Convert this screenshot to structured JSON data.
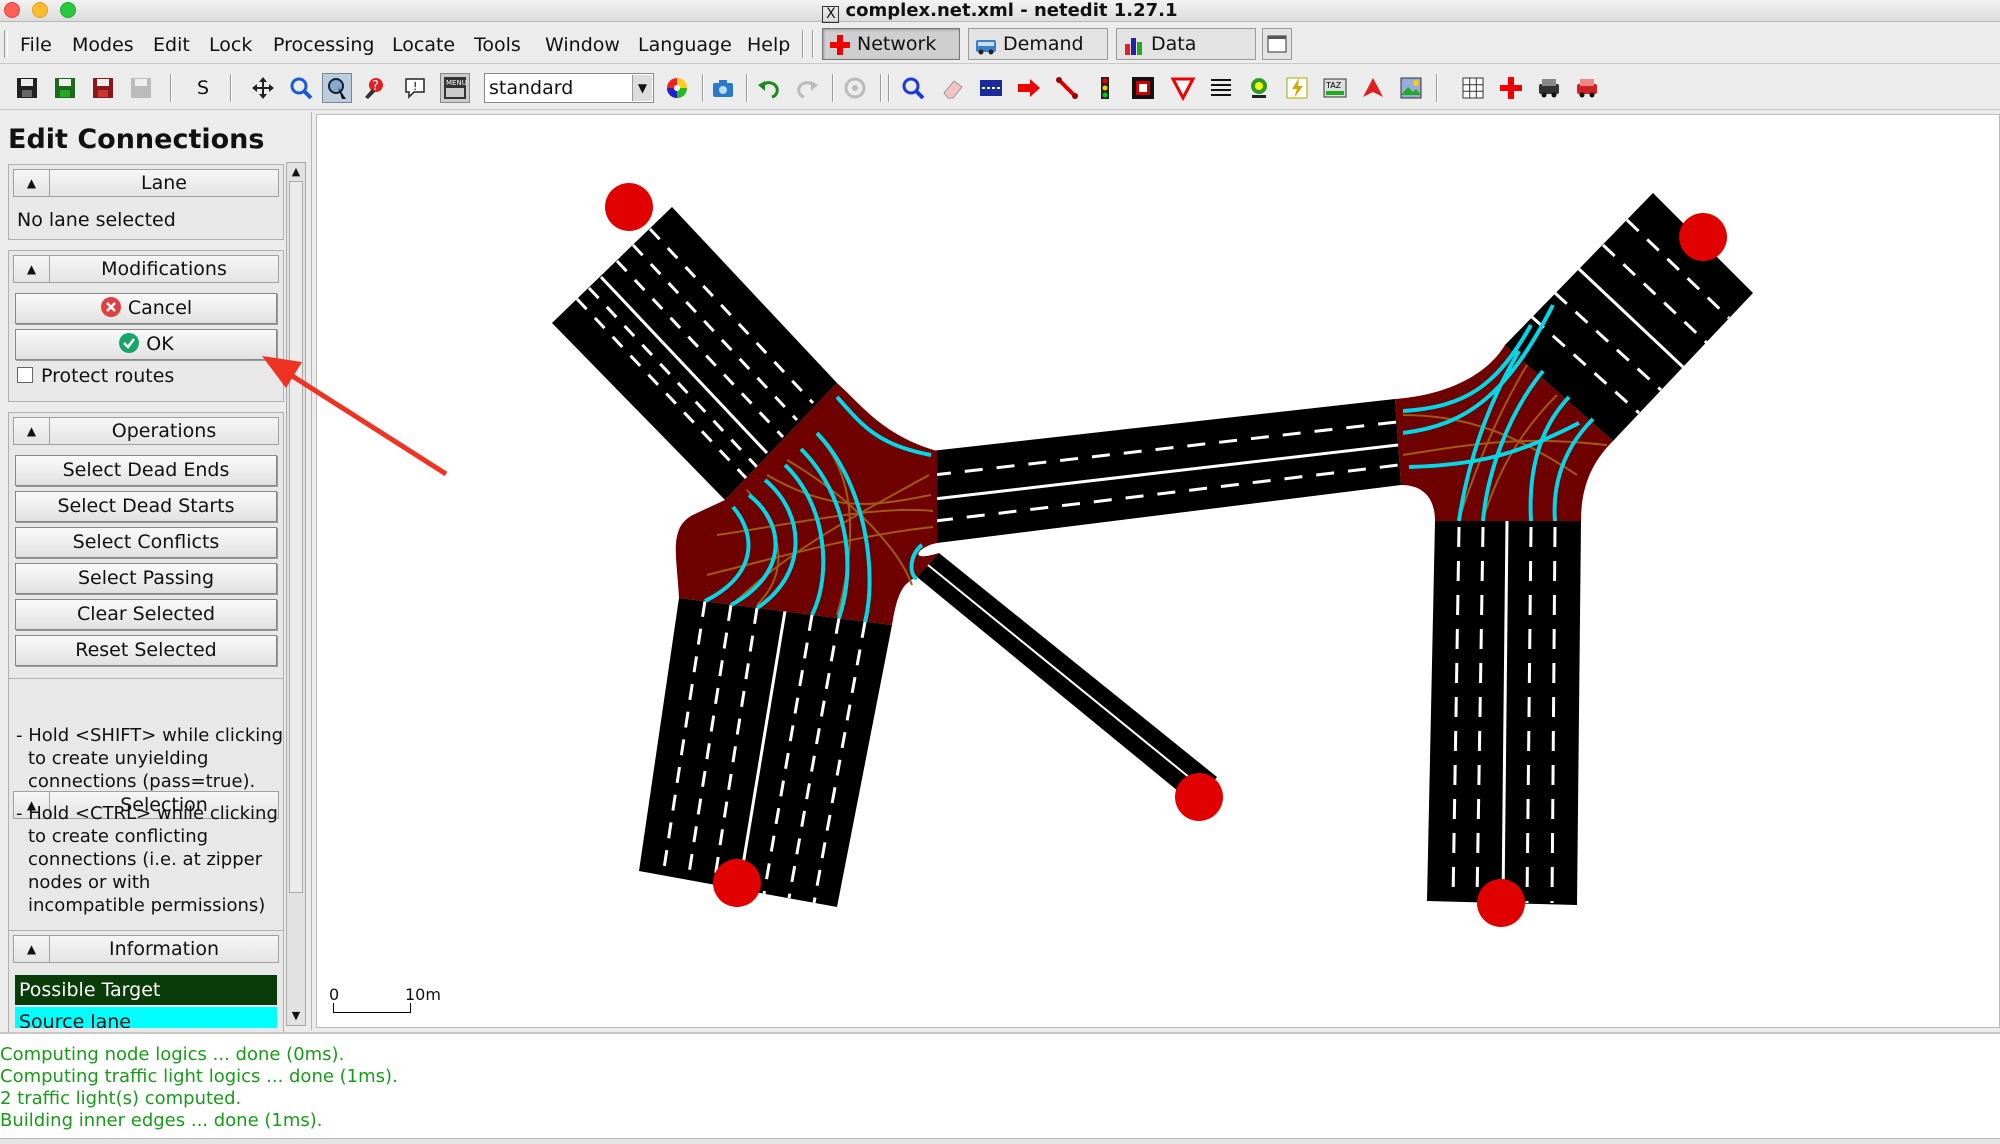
{
  "window": {
    "title": "complex.net.xml - netedit 1.27.1",
    "title_icon": "X"
  },
  "menubar": {
    "items": [
      "File",
      "Modes",
      "Edit",
      "Lock",
      "Processing",
      "Locate",
      "Tools",
      "Window",
      "Language",
      "Help"
    ],
    "supermodes": {
      "network": "Network",
      "demand": "Demand",
      "data": "Data"
    }
  },
  "toolbar": {
    "save_text": "S",
    "scheme_value": "standard"
  },
  "frame": {
    "title": "Edit Connections",
    "lane": {
      "header": "Lane",
      "status": "No lane selected"
    },
    "modifications": {
      "header": "Modifications",
      "cancel": "Cancel",
      "ok": "OK",
      "protect_routes": "Protect routes"
    },
    "operations": {
      "header": "Operations",
      "buttons": [
        "Select Dead Ends",
        "Select Dead Starts",
        "Select Conflicts",
        "Select Passing",
        "Clear Selected",
        "Reset Selected"
      ]
    },
    "selection": {
      "header": "Selection",
      "hint1": [
        "- Hold <SHIFT> while clicking",
        "to create unyielding",
        "connections (pass=true)."
      ],
      "hint2": [
        "- Hold <CTRL> while clicking",
        "to create conflicting",
        "connections (i.e. at zipper",
        "nodes or with",
        "incompatible permissions)"
      ]
    },
    "information": {
      "header": "Information",
      "legend": [
        "Possible Target",
        "Source lane"
      ]
    }
  },
  "canvas": {
    "scale_start": "0",
    "scale_end": "10m"
  },
  "messages": [
    "Computing node logics ... done (0ms).",
    "Computing traffic light logics ... done (1ms).",
    "2 traffic light(s) computed.",
    "Building inner edges ... done (1ms)."
  ],
  "colors": {
    "road": "#000000",
    "junction": "#6e0000",
    "connection": "#00d8e8",
    "connection_inner": "#a05a14",
    "dead_end": "#e00000",
    "possible_target": "#0a3c0a",
    "source_lane": "#00ffff",
    "annotation_arrow": "#ee3322",
    "log_text": "#1a9a1a"
  }
}
